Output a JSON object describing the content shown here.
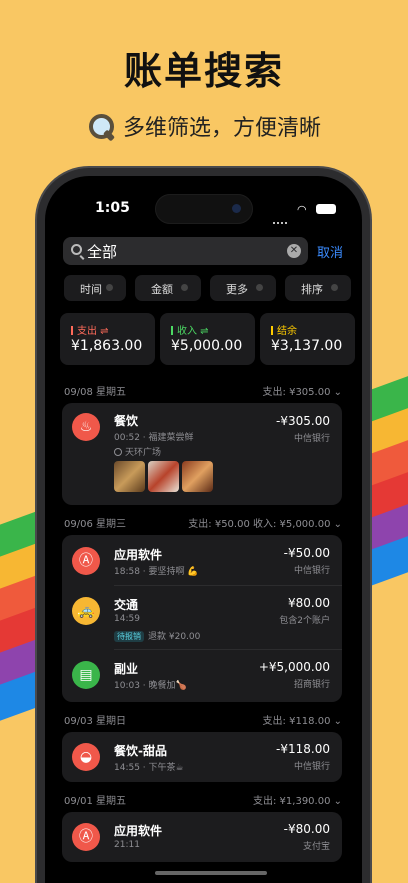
{
  "hero": {
    "title": "账单搜索",
    "subtitle": "多维筛选，方便清晰",
    "icon": "magnifier-icon"
  },
  "colors": {
    "background": "#f9c763",
    "accent": "#3b8cff",
    "expense": "#ff6b5a",
    "income": "#4cd964",
    "balance": "#ffcc00",
    "stripes": [
      "#3ab54a",
      "#f7b733",
      "#ef5a3c",
      "#e53935",
      "#8e44ad",
      "#1e88e5"
    ]
  },
  "status_bar": {
    "time": "05"
  },
  "search": {
    "value": "全部",
    "placeholder": "",
    "cancel_label": "取消"
  },
  "filters": [
    "时间",
    "金额",
    "更多",
    "排序"
  ],
  "summary": {
    "expense": {
      "label": "支出 ⇌",
      "value": "¥1,863.00"
    },
    "income": {
      "label": "收入 ⇌",
      "value": "¥5,000.00"
    },
    "balance": {
      "label": "结余",
      "value": "¥3,137.00"
    }
  },
  "days": [
    {
      "date": "09/08 星期五",
      "summary": "支出: ¥305.00 ⌄",
      "items": [
        {
          "title": "餐饮",
          "time_note": "00:52 · 福建菜尝鲜",
          "location": "天环广场",
          "amount": "-¥305.00",
          "account": "中信银行",
          "icon": "food-icon",
          "color": "#f0584a"
        }
      ]
    },
    {
      "date": "09/06 星期三",
      "summary": "支出: ¥50.00  收入: ¥5,000.00 ⌄",
      "items": [
        {
          "title": "应用软件",
          "time_note": "18:58 · 要坚持啊 💪",
          "amount": "-¥50.00",
          "account": "中信银行",
          "icon": "app-store-icon",
          "color": "#f0584a"
        },
        {
          "title": "交通",
          "time_note": "14:59",
          "tag": "待报销",
          "tag_note": "退款 ¥20.00",
          "amount": "¥80.00",
          "account": "包含2个账户",
          "icon": "taxi-icon",
          "color": "#f7b733"
        },
        {
          "title": "副业",
          "time_note": "10:03 · 晚餐加🍗",
          "amount": "+¥5,000.00",
          "account": "招商银行",
          "icon": "side-job-icon",
          "color": "#3ab54a"
        }
      ]
    },
    {
      "date": "09/03 星期日",
      "summary": "支出: ¥118.00 ⌄",
      "items": [
        {
          "title": "餐饮-甜品",
          "time_note": "14:55 · 下午茶☕",
          "amount": "-¥118.00",
          "account": "中信银行",
          "icon": "dessert-icon",
          "color": "#f0584a"
        }
      ]
    },
    {
      "date": "09/01 星期五",
      "summary": "支出: ¥1,390.00 ⌄",
      "items": [
        {
          "title": "应用软件",
          "time_note": "21:11",
          "amount": "-¥80.00",
          "account": "支付宝",
          "icon": "app-store-icon",
          "color": "#f0584a"
        }
      ]
    }
  ]
}
